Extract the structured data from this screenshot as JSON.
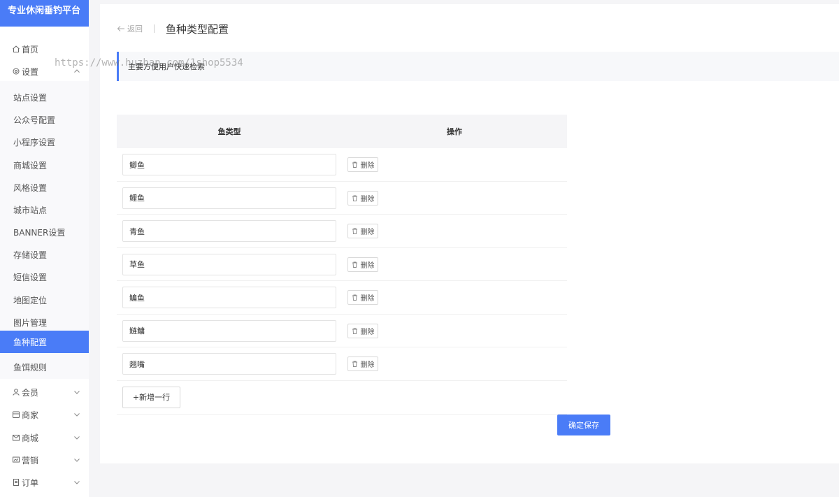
{
  "app": {
    "brand": "专业休闲垂钓平台"
  },
  "sidebar": {
    "home": "首页",
    "settings": "设置",
    "settings_items": [
      "站点设置",
      "公众号配置",
      "小程序设置",
      "商城设置",
      "风格设置",
      "城市站点",
      "BANNER设置",
      "存储设置",
      "短信设置",
      "地图定位",
      "图片管理",
      "鱼种配置",
      "鱼饵规则"
    ],
    "active_index": 11,
    "member": "会员",
    "merchant": "商家",
    "mall": "商城",
    "marketing": "营销",
    "orders": "订单"
  },
  "header": {
    "back": "返回",
    "title": "鱼种类型配置"
  },
  "notice": {
    "text": "主要方便用户快速检索",
    "watermark": "https://www.huzhan.com/1shop5534"
  },
  "table": {
    "col_type": "鱼类型",
    "col_action": "操作",
    "delete_label": "删除",
    "rows": [
      "鲫鱼",
      "鲤鱼",
      "青鱼",
      "草鱼",
      "鳊鱼",
      "鲢鳙",
      "翘嘴"
    ]
  },
  "actions": {
    "add_row": "+新增一行",
    "save": "确定保存"
  },
  "colors": {
    "accent": "#4a7cf7",
    "background": "#f5f5f7"
  }
}
